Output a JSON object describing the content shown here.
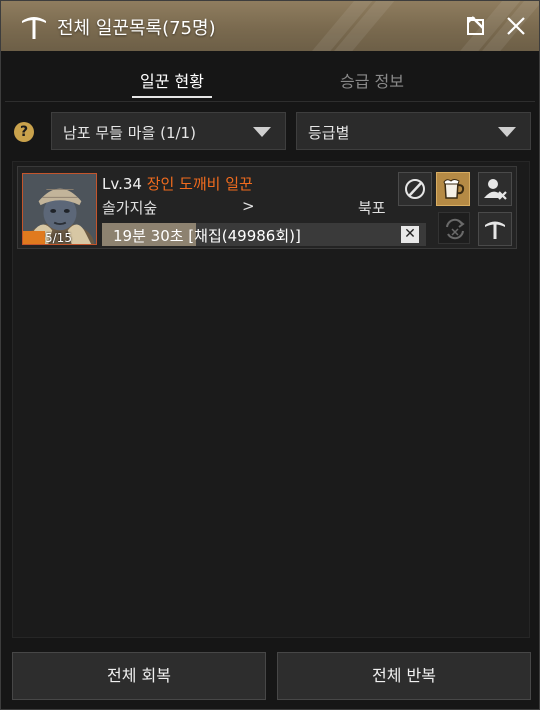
{
  "window": {
    "title": "전체 일꾼목록(75명)"
  },
  "tabs": [
    {
      "label": "일꾼 현황",
      "active": true
    },
    {
      "label": "승급 정보",
      "active": false
    }
  ],
  "filters": {
    "help_glyph": "?",
    "town": "남포 무들 마을 (1/1)",
    "sort": "등급별"
  },
  "workers": [
    {
      "level": "Lv.34",
      "name": "장인 도깨비 일꾼",
      "stamina": "5/15",
      "stamina_fraction": 0.333,
      "from": "솔가지숲",
      "arrow": ">",
      "to": "북포",
      "progress_text": "19분 30초 [채집(49986회)]",
      "progress_fraction": 0.29,
      "cancel_glyph": "✕",
      "name_color": "#f06b1e"
    }
  ],
  "buttons": {
    "recover_all": "전체 회복",
    "repeat_all": "전체 반복"
  },
  "colors": {
    "accent": "#c9a24c",
    "titlebar": "#7a6a4f",
    "highlight_action": "#b58a45"
  }
}
